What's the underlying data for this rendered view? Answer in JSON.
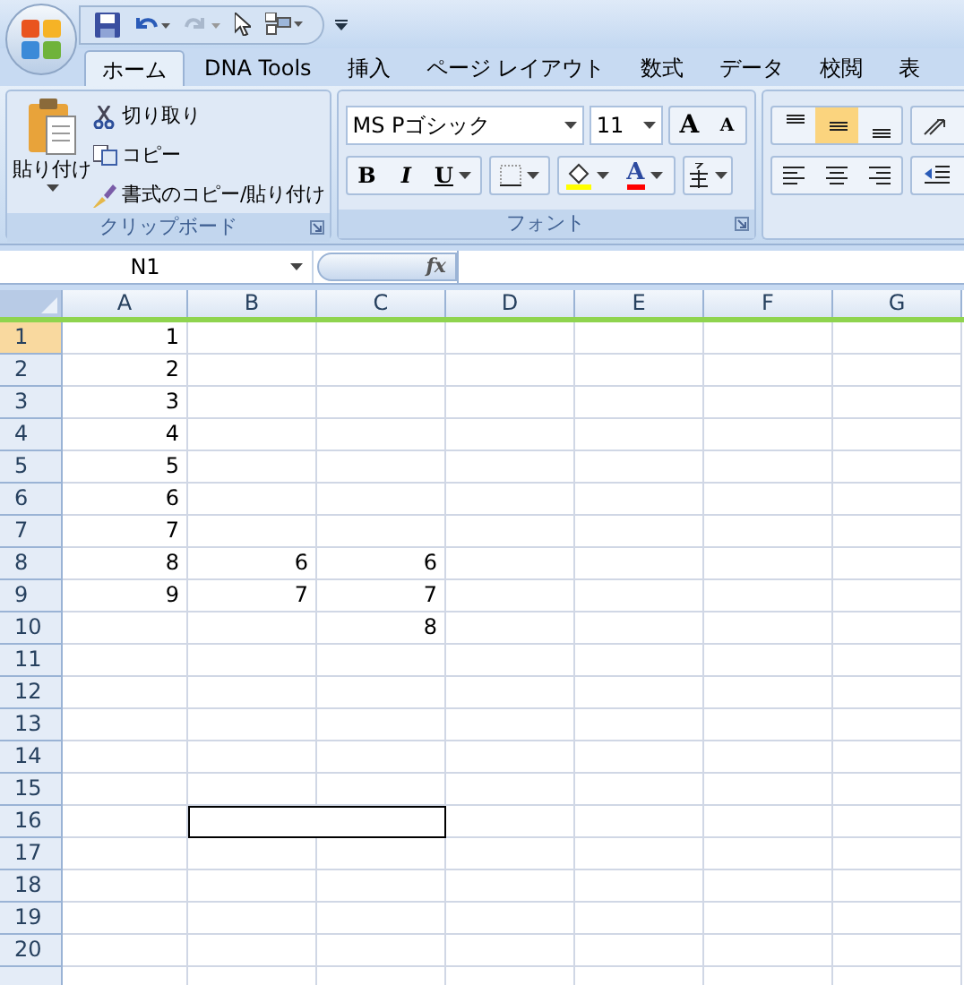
{
  "tabs": [
    {
      "label": "ホーム",
      "selected": true
    },
    {
      "label": "DNA Tools",
      "selected": false
    },
    {
      "label": "挿入",
      "selected": false
    },
    {
      "label": "ページ レイアウト",
      "selected": false
    },
    {
      "label": "数式",
      "selected": false
    },
    {
      "label": "データ",
      "selected": false
    },
    {
      "label": "校閲",
      "selected": false
    },
    {
      "label": "表",
      "selected": false
    }
  ],
  "clipboard": {
    "paste": "貼り付け",
    "cut": "切り取り",
    "copy": "コピー",
    "format_painter": "書式のコピー/貼り付け",
    "label": "クリップボード"
  },
  "font": {
    "name": "MS Pゴシック",
    "size": "11",
    "grow": "A",
    "shrink": "A",
    "bold": "B",
    "italic": "I",
    "underline": "U",
    "color_letter": "A",
    "label": "フォント"
  },
  "alignment": [
    {
      "kind": "top",
      "selected": false
    },
    {
      "kind": "middle",
      "selected": true
    },
    {
      "kind": "bottom",
      "selected": false
    },
    {
      "kind": "left",
      "selected": false
    },
    {
      "kind": "center",
      "selected": false
    },
    {
      "kind": "right",
      "selected": false
    }
  ],
  "name_box": "N1",
  "fx": "fx",
  "columns": [
    "A",
    "B",
    "C",
    "D",
    "E",
    "F",
    "G"
  ],
  "rows": [
    {
      "header": "1",
      "selected": true,
      "cells": [
        "1",
        null,
        null,
        null,
        null,
        null,
        null
      ]
    },
    {
      "header": "2",
      "selected": false,
      "cells": [
        "2",
        null,
        null,
        null,
        null,
        null,
        null
      ]
    },
    {
      "header": "3",
      "selected": false,
      "cells": [
        "3",
        null,
        null,
        null,
        null,
        null,
        null
      ]
    },
    {
      "header": "4",
      "selected": false,
      "cells": [
        "4",
        null,
        null,
        null,
        null,
        null,
        null
      ]
    },
    {
      "header": "5",
      "selected": false,
      "cells": [
        "5",
        null,
        null,
        null,
        null,
        null,
        null
      ]
    },
    {
      "header": "6",
      "selected": false,
      "cells": [
        "6",
        null,
        null,
        null,
        null,
        null,
        null
      ]
    },
    {
      "header": "7",
      "selected": false,
      "cells": [
        "7",
        null,
        null,
        null,
        null,
        null,
        null
      ]
    },
    {
      "header": "8",
      "selected": false,
      "cells": [
        "8",
        "6",
        "6",
        null,
        null,
        null,
        null
      ]
    },
    {
      "header": "9",
      "selected": false,
      "cells": [
        "9",
        "7",
        "7",
        null,
        null,
        null,
        null
      ]
    },
    {
      "header": "10",
      "selected": false,
      "cells": [
        null,
        null,
        "8",
        null,
        null,
        null,
        null
      ]
    },
    {
      "header": "11",
      "selected": false,
      "cells": [
        null,
        null,
        null,
        null,
        null,
        null,
        null
      ]
    },
    {
      "header": "12",
      "selected": false,
      "cells": [
        null,
        null,
        null,
        null,
        null,
        null,
        null
      ]
    },
    {
      "header": "13",
      "selected": false,
      "cells": [
        null,
        null,
        null,
        null,
        null,
        null,
        null
      ]
    },
    {
      "header": "14",
      "selected": false,
      "cells": [
        null,
        null,
        null,
        null,
        null,
        null,
        null
      ]
    },
    {
      "header": "15",
      "selected": false,
      "cells": [
        null,
        null,
        null,
        null,
        null,
        null,
        null
      ]
    },
    {
      "header": "16",
      "selected": false,
      "cells": [
        null,
        null,
        null,
        null,
        null,
        null,
        null
      ],
      "outlined": [
        false,
        true,
        true,
        false,
        false,
        false,
        false
      ]
    },
    {
      "header": "17",
      "selected": false,
      "cells": [
        null,
        null,
        null,
        null,
        null,
        null,
        null
      ]
    },
    {
      "header": "18",
      "selected": false,
      "cells": [
        null,
        null,
        null,
        null,
        null,
        null,
        null
      ]
    },
    {
      "header": "19",
      "selected": false,
      "cells": [
        null,
        null,
        null,
        null,
        null,
        null,
        null
      ]
    },
    {
      "header": "20",
      "selected": false,
      "cells": [
        null,
        null,
        null,
        null,
        null,
        null,
        null
      ]
    }
  ]
}
